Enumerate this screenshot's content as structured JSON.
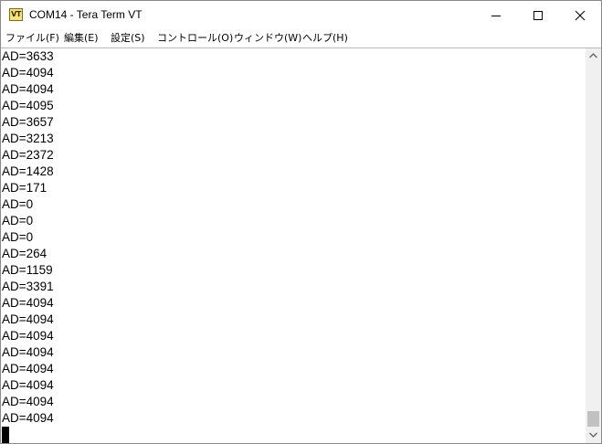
{
  "window": {
    "title": "COM14 - Tera Term VT",
    "icon_label": "VT"
  },
  "menu": {
    "items": [
      {
        "label": "ファイル(F)"
      },
      {
        "label": "編集(E)"
      },
      {
        "label": "設定(S)"
      },
      {
        "label": "コントロール(O)"
      },
      {
        "label": "ウィンドウ(W)"
      },
      {
        "label": "ヘルプ(H)"
      }
    ]
  },
  "terminal": {
    "lines": [
      "AD=3633",
      "AD=4094",
      "AD=4094",
      "AD=4095",
      "AD=3657",
      "AD=3213",
      "AD=2372",
      "AD=1428",
      "AD=171",
      "AD=0",
      "AD=0",
      "AD=0",
      "AD=264",
      "AD=1159",
      "AD=3391",
      "AD=4094",
      "AD=4094",
      "AD=4094",
      "AD=4094",
      "AD=4094",
      "AD=4094",
      "AD=4094",
      "AD=4094"
    ]
  },
  "icons": {
    "app": "tera-term-icon",
    "minimize": "minimize-icon",
    "maximize": "maximize-icon",
    "close": "close-icon",
    "scroll_up": "scroll-up-arrow-icon",
    "scroll_down": "scroll-down-arrow-icon"
  }
}
